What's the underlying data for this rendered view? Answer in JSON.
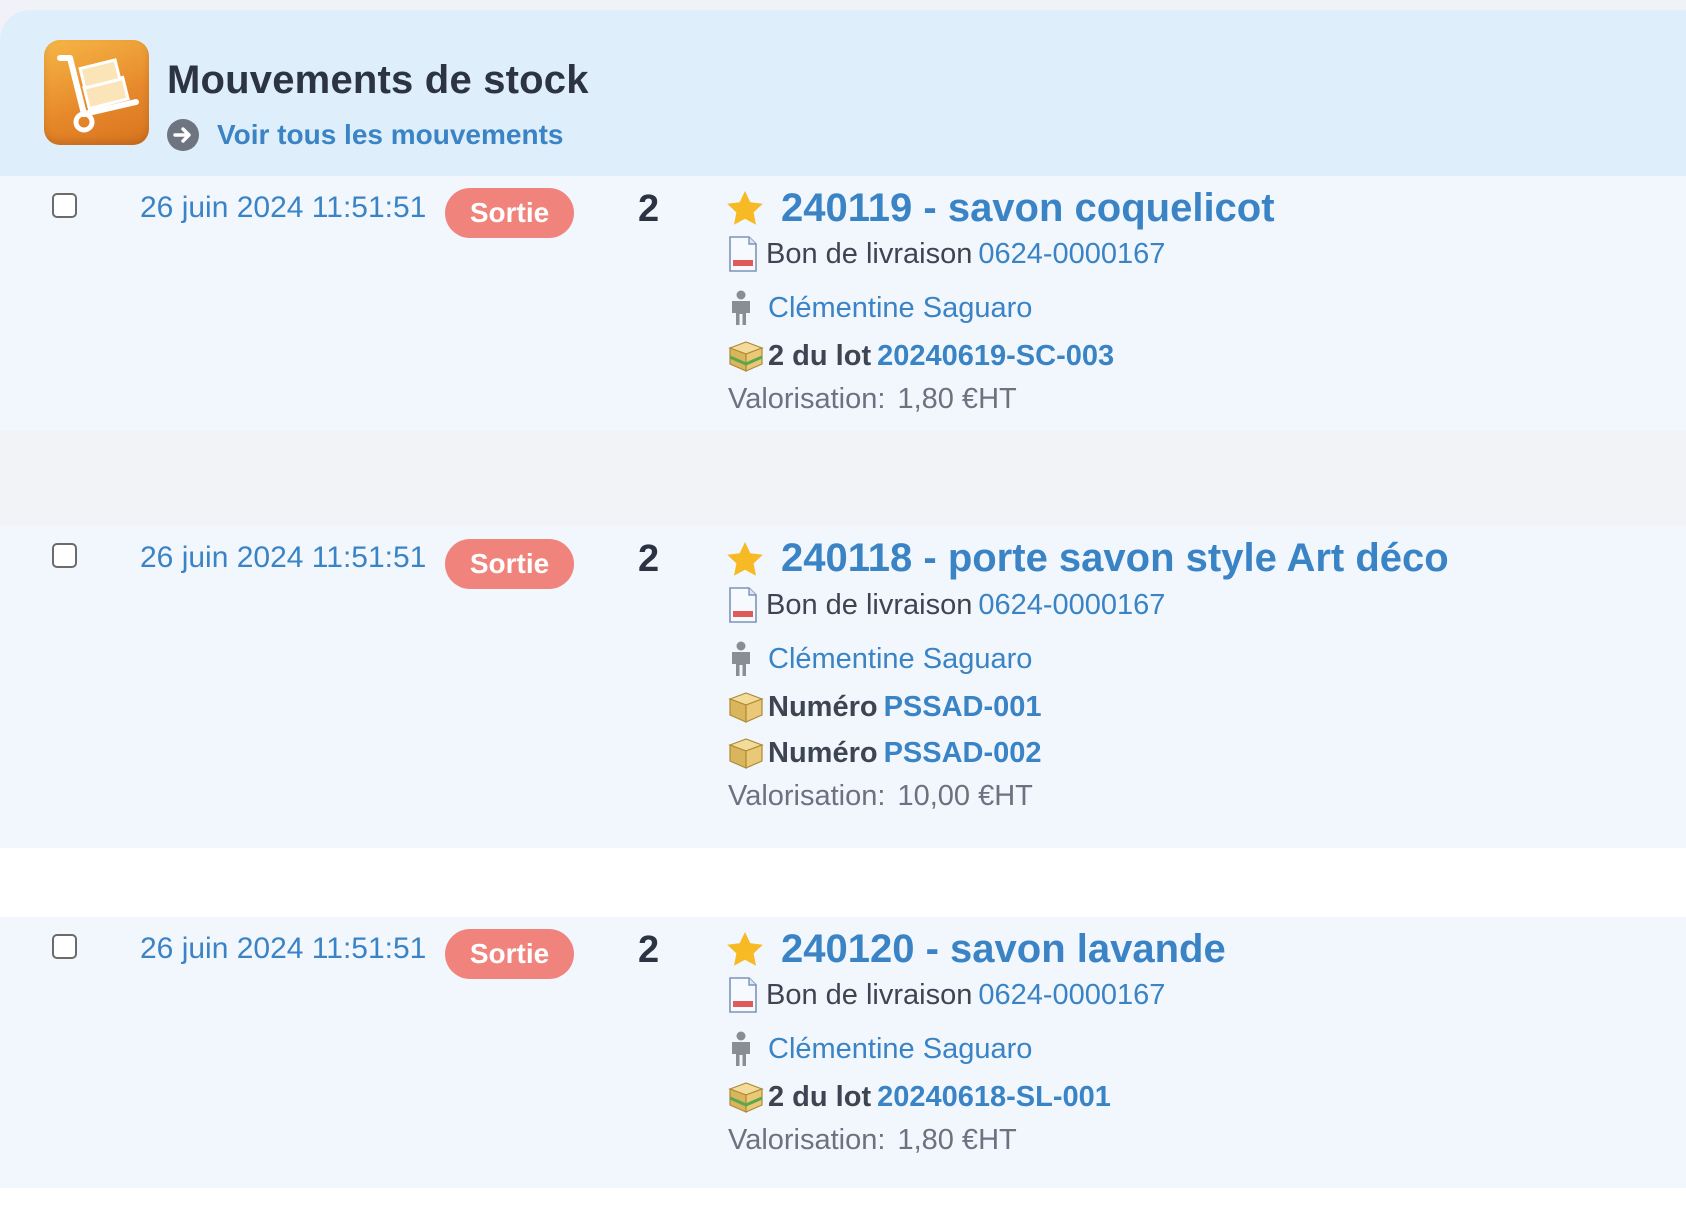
{
  "header": {
    "title": "Mouvements de stock",
    "see_all_label": "Voir tous les mouvements",
    "app_icon": "hand-truck-icon"
  },
  "colors": {
    "link": "#3a83c5",
    "badge": "#f0847d",
    "header_bg": "#dfeefb",
    "row_bg": "#f1f7fd",
    "star": "#f7b924"
  },
  "movements": [
    {
      "date": "26 juin 2024 11:51:51",
      "type": "Sortie",
      "quantity": "2",
      "product": "240119 - savon coquelicot",
      "doc_label": "Bon de livraison",
      "doc_number": "0624-0000167",
      "person": "Clémentine Saguaro",
      "lots": [
        {
          "label": "2 du lot",
          "value": "20240619-SC-003"
        }
      ],
      "valuation_label": "Valorisation:",
      "valuation": "1,80 €HT"
    },
    {
      "date": "26 juin 2024 11:51:51",
      "type": "Sortie",
      "quantity": "2",
      "product": "240118 - porte savon style Art déco",
      "doc_label": "Bon de livraison",
      "doc_number": "0624-0000167",
      "person": "Clémentine Saguaro",
      "lots": [
        {
          "label": "Numéro",
          "value": "PSSAD-001"
        },
        {
          "label": "Numéro",
          "value": "PSSAD-002"
        }
      ],
      "valuation_label": "Valorisation:",
      "valuation": "10,00 €HT"
    },
    {
      "date": "26 juin 2024 11:51:51",
      "type": "Sortie",
      "quantity": "2",
      "product": "240120 - savon lavande",
      "doc_label": "Bon de livraison",
      "doc_number": "0624-0000167",
      "person": "Clémentine Saguaro",
      "lots": [
        {
          "label": "2 du lot",
          "value": "20240618-SL-001"
        }
      ],
      "valuation_label": "Valorisation:",
      "valuation": "1,80 €HT"
    }
  ]
}
